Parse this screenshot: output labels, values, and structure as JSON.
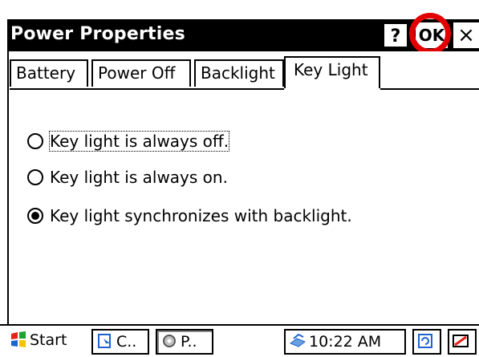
{
  "window": {
    "title": "Power Properties",
    "help_label": "?",
    "ok_label": "OK",
    "close_label": "×"
  },
  "tabs": [
    {
      "label": "Battery"
    },
    {
      "label": "Power Off"
    },
    {
      "label": "Backlight"
    },
    {
      "label": "Key Light",
      "active": true
    }
  ],
  "options": [
    {
      "label": "Key light is always off.",
      "checked": false
    },
    {
      "label": "Key light is always on.",
      "checked": false
    },
    {
      "label": "Key light synchronizes with backlight.",
      "checked": true
    }
  ],
  "taskbar": {
    "start_label": "Start",
    "task1_label": "C..",
    "task2_label": "P..",
    "clock": "10:22 AM"
  },
  "colors": {
    "highlight_ring": "#e30000",
    "titlebar_bg": "#000000"
  }
}
